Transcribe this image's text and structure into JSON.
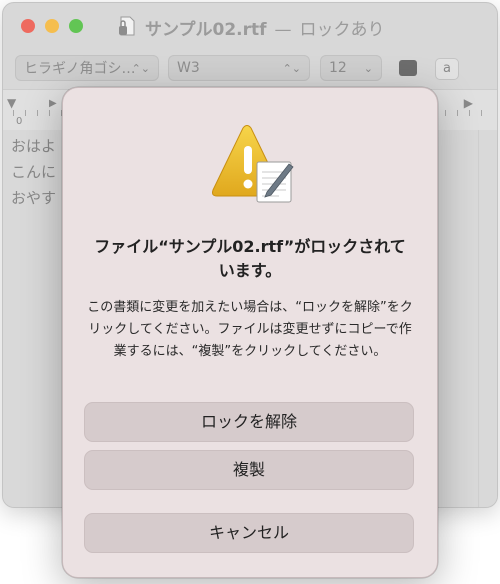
{
  "window": {
    "title": "サンプル02.rtf",
    "separator": "—",
    "status": "ロックあり"
  },
  "toolbar": {
    "font_family": "ヒラギノ角ゴシ…",
    "font_weight": "W3",
    "font_size": "12",
    "highlight_glyph": "a"
  },
  "ruler": {
    "zero_label": "0"
  },
  "document": {
    "lines": [
      "おはよ",
      "こんに",
      "おやす"
    ]
  },
  "alert": {
    "title": "ファイル“サンプル02.rtf”がロックされています。",
    "message": "この書類に変更を加えたい場合は、“ロックを解除”をクリックしてください。ファイルは変更せずにコピーで作業するには、“複製”をクリックしてください。",
    "buttons": {
      "unlock": "ロックを解除",
      "duplicate": "複製",
      "cancel": "キャンセル"
    }
  },
  "icons": {
    "alert": "warning-document-icon",
    "title_doc": "rtf-document-icon"
  }
}
